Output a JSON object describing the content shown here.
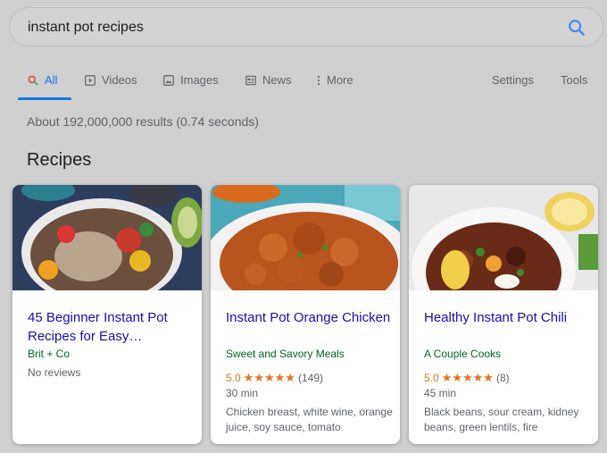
{
  "search": {
    "query": "instant pot recipes"
  },
  "tabs": [
    {
      "label": "All",
      "icon": "search-icon"
    },
    {
      "label": "Videos",
      "icon": "video-icon"
    },
    {
      "label": "Images",
      "icon": "image-icon"
    },
    {
      "label": "News",
      "icon": "news-icon"
    },
    {
      "label": "More",
      "icon": "more-vert-icon"
    },
    {
      "label": "Settings"
    },
    {
      "label": "Tools"
    }
  ],
  "results_stats": "About 192,000,000 results (0.74 seconds)",
  "section_title": "Recipes",
  "colors": {
    "link": "#1a0dab",
    "source": "#006621",
    "rating": "#e7711b",
    "accent": "#1a73e8"
  },
  "cards": [
    {
      "title": "45 Beginner Instant Pot Recipes for Easy…",
      "source": "Brit + Co",
      "reviews": "No reviews"
    },
    {
      "title": "Instant Pot Orange Chicken",
      "source": "Sweet and Savory Meals",
      "rating": "5.0",
      "stars": "★★★★★",
      "count": "(149)",
      "time": "30 min",
      "ingredients": "Chicken breast, white wine, orange juice, soy sauce, tomato"
    },
    {
      "title": "Healthy Instant Pot Chili",
      "source": "A Couple Cooks",
      "rating": "5.0",
      "stars": "★★★★★",
      "count": "(8)",
      "time": "45 min",
      "ingredients": "Black beans, sour cream, kidney beans, green lentils, fire"
    }
  ]
}
